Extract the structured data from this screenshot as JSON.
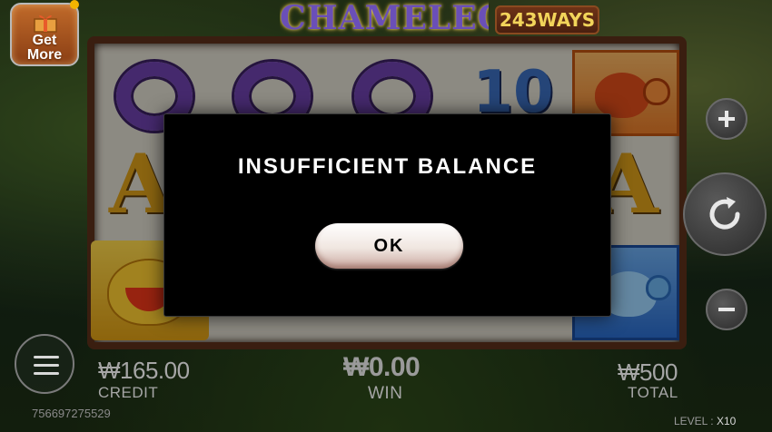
{
  "game": {
    "title": "CHAMELEON",
    "ways_badge": "243WAYS"
  },
  "get_more": {
    "label_line1": "Get",
    "label_line2": "More"
  },
  "reels": {
    "visible_symbols": [
      "O",
      "O",
      "O",
      "10",
      "A",
      "A"
    ]
  },
  "controls": {
    "plus_icon": "plus-icon",
    "spin_icon": "refresh-icon",
    "minus_icon": "minus-icon",
    "menu_icon": "hamburger-icon"
  },
  "stats": {
    "credit_value": "₩165.00",
    "credit_label": "CREDIT",
    "win_value": "₩0.00",
    "win_label": "WIN",
    "total_value": "₩500",
    "total_label": "TOTAL"
  },
  "footer": {
    "session_id": "756697275529",
    "level_label": "LEVEL :",
    "level_value": "X10"
  },
  "modal": {
    "message": "INSUFFICIENT BALANCE",
    "ok_label": "OK"
  },
  "colors": {
    "modal_bg": "#000000",
    "accent_gold": "#f2d45a",
    "reel_frame": "#5a2e1a"
  }
}
